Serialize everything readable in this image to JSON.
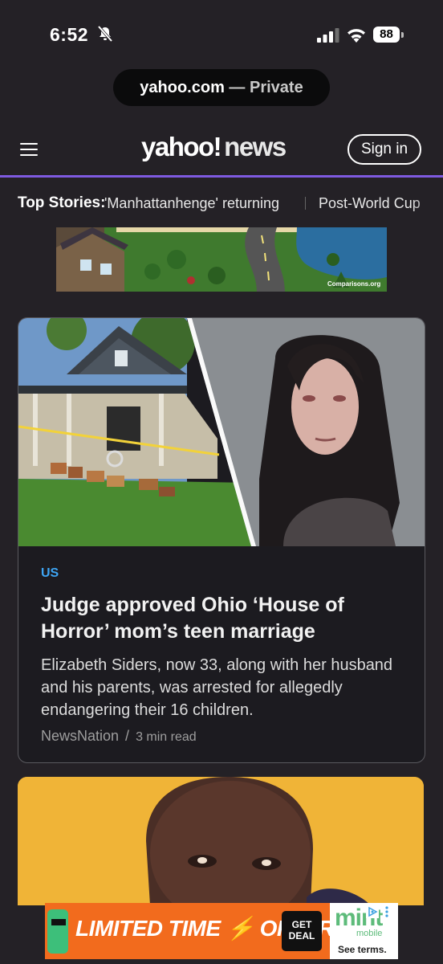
{
  "status_bar": {
    "time": "6:52",
    "battery": "88"
  },
  "browser": {
    "domain": "yahoo.com",
    "separator": " — ",
    "mode": "Private"
  },
  "header": {
    "logo_main": "yahoo!",
    "logo_section": "news",
    "signin_label": "Sign in"
  },
  "top_stories": {
    "label": "Top Stories:",
    "items": [
      "'Manhattanhenge' returning",
      "Post-World Cup"
    ]
  },
  "ad_top": {
    "source": "Comparisons.org"
  },
  "article": {
    "category": "US",
    "headline": "Judge approved Ohio ‘House of Horror’ mom’s teen marriage",
    "summary": "Elizabeth Siders, now 33, along with her husband and his parents, was arrested for allegedly endangering their 16 children.",
    "source": "NewsNation",
    "read_time": "3 min read"
  },
  "bottom_ad": {
    "headline_1": "LIMITED TIME",
    "headline_2": "OFFER",
    "cta": "GET DEAL",
    "brand": "mint",
    "brand_sub": "mobile",
    "terms": "See terms."
  },
  "colors": {
    "accent": "#7e5ae0",
    "category": "#3ea6f5",
    "ad_orange": "#f26b1d",
    "background": "#242126"
  }
}
